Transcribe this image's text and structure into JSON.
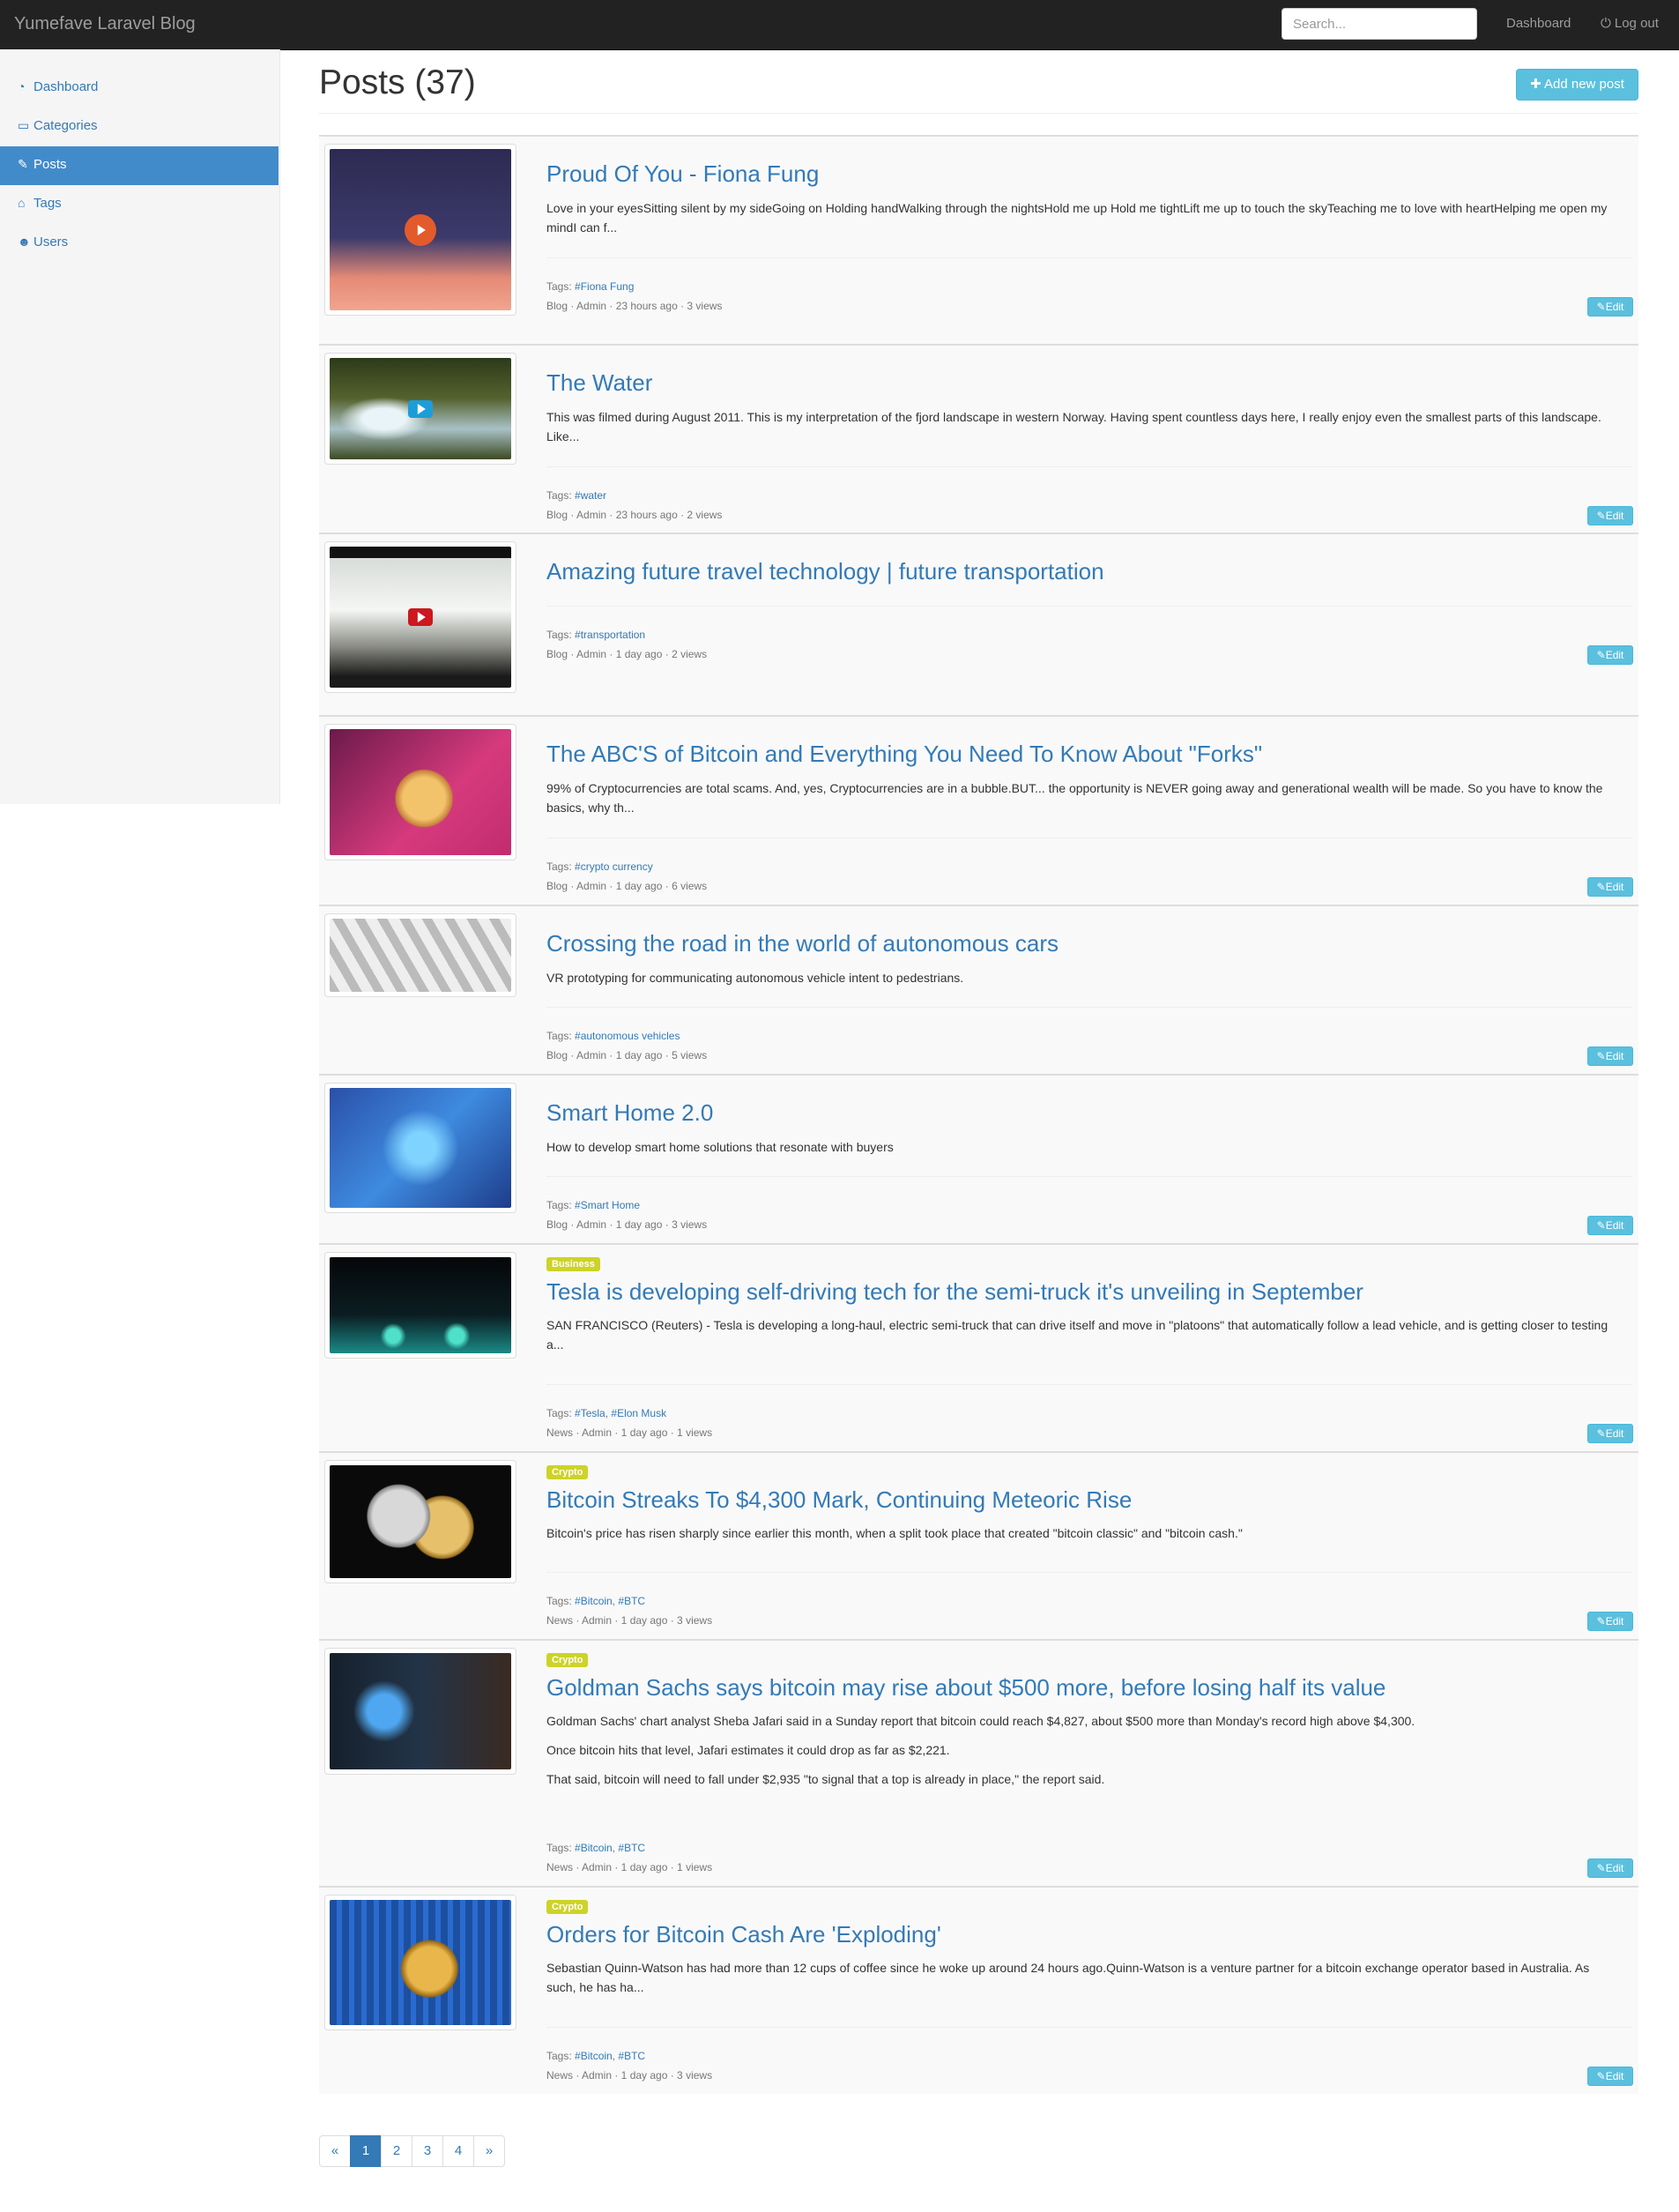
{
  "navbar": {
    "brand": "Yumefave Laravel Blog",
    "search_placeholder": "Search...",
    "dashboard_label": "Dashboard",
    "logout_label": "Log out"
  },
  "sidebar": {
    "items": [
      {
        "label": "Dashboard",
        "icon": "tachometer-icon",
        "active": false
      },
      {
        "label": "Categories",
        "icon": "folder-open-icon",
        "active": false
      },
      {
        "label": "Posts",
        "icon": "pencil-icon",
        "active": true
      },
      {
        "label": "Tags",
        "icon": "tags-icon",
        "active": false
      },
      {
        "label": "Users",
        "icon": "users-icon",
        "active": false
      }
    ]
  },
  "main": {
    "title": "Posts (37)",
    "add_button_label": "Add new post",
    "edit_label": "Edit",
    "tags_label": "Tags:"
  },
  "posts": [
    {
      "title": "Proud Of You - Fiona Fung",
      "category_badge": "",
      "excerpt": [
        "Love in your eyesSitting silent by my sideGoing on Holding handWalking through the nightsHold me up Hold me tightLift me up to touch the skyTeaching me to love with heartHelping me open my mindI can f..."
      ],
      "tags": [
        "#Fiona Fung"
      ],
      "meta": "Blog · Admin · 23 hours ago · 3 views",
      "thumbnail": "video-thumbnail-fiona"
    },
    {
      "title": "The Water",
      "category_badge": "",
      "excerpt": [
        "This was filmed during August 2011. This is my interpretation of the fjord landscape in western Norway. Having spent countless days here, I really enjoy even the smallest parts of this landscape. Like..."
      ],
      "tags": [
        "#water"
      ],
      "meta": "Blog · Admin · 23 hours ago · 2 views",
      "thumbnail": "video-thumbnail-water"
    },
    {
      "title": "Amazing future travel technology | future transportation",
      "category_badge": "",
      "excerpt": [],
      "tags": [
        "#transportation"
      ],
      "meta": "Blog · Admin · 1 day ago · 2 views",
      "thumbnail": "video-thumbnail-train"
    },
    {
      "title": "The ABC'S of Bitcoin and Everything You Need To Know About \"Forks\"",
      "category_badge": "",
      "excerpt": [
        "99% of Cryptocurrencies are total scams. And, yes, Cryptocurrencies are in a bubble.BUT... the opportunity is NEVER going away and generational wealth will be made. So you have to know the basics, why th..."
      ],
      "tags": [
        "#crypto currency"
      ],
      "meta": "Blog · Admin · 1 day ago · 6 views",
      "thumbnail": "bitcoin-image"
    },
    {
      "title": "Crossing the road in the world of autonomous cars",
      "category_badge": "",
      "excerpt": [
        "VR prototyping for communicating autonomous vehicle intent to pedestrians."
      ],
      "tags": [
        "#autonomous vehicles"
      ],
      "meta": "Blog · Admin · 1 day ago · 5 views",
      "thumbnail": "roads-image"
    },
    {
      "title": "Smart Home 2.0",
      "category_badge": "",
      "excerpt": [
        "How to develop smart home solutions that resonate with buyers"
      ],
      "tags": [
        "#Smart Home"
      ],
      "meta": "Blog · Admin · 1 day ago · 3 views",
      "thumbnail": "smart-home-image"
    },
    {
      "title": "Tesla is developing self-driving tech for the semi-truck it's unveiling in September",
      "category_badge": "Business",
      "excerpt": [
        "SAN FRANCISCO (Reuters) - Tesla is developing a long-haul, electric semi-truck that can drive itself and move in \"platoons\" that automatically follow a lead vehicle, and is getting closer to testing a..."
      ],
      "tags": [
        "#Tesla",
        "#Elon Musk"
      ],
      "meta": "News · Admin · 1 day ago · 1 views",
      "thumbnail": "tesla-truck-image"
    },
    {
      "title": "Bitcoin Streaks To $4,300 Mark, Continuing Meteoric Rise",
      "category_badge": "Crypto",
      "excerpt": [
        "Bitcoin's price has risen sharply since earlier this month, when a split took place that created \"bitcoin classic\" and \"bitcoin cash.\""
      ],
      "tags": [
        "#Bitcoin",
        "#BTC"
      ],
      "meta": "News · Admin · 1 day ago · 3 views",
      "thumbnail": "coins-image"
    },
    {
      "title": "Goldman Sachs says bitcoin may rise about $500 more, before losing half its value",
      "category_badge": "Crypto",
      "excerpt": [
        "Goldman Sachs' chart analyst Sheba Jafari said in a Sunday report that bitcoin could reach $4,827, about $500 more than Monday's record high above $4,300.",
        "Once bitcoin hits that level, Jafari estimates it could drop as far as $2,221.",
        "That said, bitcoin will need to fall under $2,935 \"to signal that a top is already in place,\" the report said."
      ],
      "tags": [
        "#Bitcoin",
        "#BTC"
      ],
      "meta": "News · Admin · 1 day ago · 1 views",
      "thumbnail": "bitcoin-atm-image"
    },
    {
      "title": "Orders for Bitcoin Cash Are 'Exploding'",
      "category_badge": "Crypto",
      "excerpt": [
        "Sebastian Quinn-Watson has had more than 12 cups of coffee since he woke up around 24 hours ago.Quinn-Watson is a venture partner for a bitcoin exchange operator based in Australia. As such, he has ha..."
      ],
      "tags": [
        "#Bitcoin",
        "#BTC"
      ],
      "meta": "News · Admin · 1 day ago · 3 views",
      "thumbnail": "bitcoin-keyboard-image"
    }
  ],
  "pagination": {
    "prev": "«",
    "pages": [
      "1",
      "2",
      "3",
      "4"
    ],
    "active_page": "1",
    "next": "»"
  }
}
